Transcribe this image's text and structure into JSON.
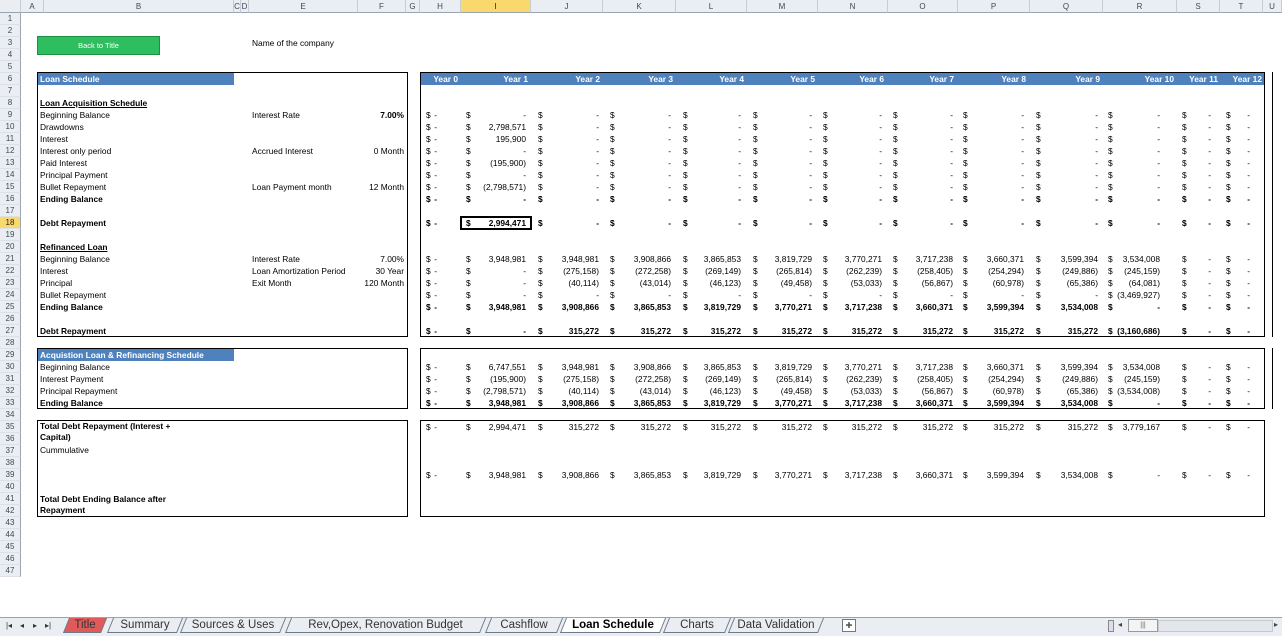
{
  "columns": [
    "A",
    "B",
    "C",
    "D",
    "E",
    "F",
    "G",
    "H",
    "I",
    "J",
    "K",
    "L",
    "M",
    "N",
    "O",
    "P",
    "Q",
    "R",
    "S",
    "T",
    "U"
  ],
  "rows": [
    "1",
    "2",
    "3",
    "4",
    "5",
    "6",
    "7",
    "8",
    "9",
    "10",
    "11",
    "12",
    "13",
    "14",
    "15",
    "16",
    "17",
    "18",
    "19",
    "20",
    "21",
    "22",
    "23",
    "24",
    "25",
    "26",
    "27",
    "28",
    "29",
    "30",
    "31",
    "32",
    "33",
    "34",
    "35",
    "36",
    "37",
    "38",
    "39",
    "40",
    "41",
    "42",
    "43",
    "44",
    "45",
    "46",
    "47"
  ],
  "back_button": "Back to Title",
  "company_label": "Name of the company",
  "loan_schedule_title": "Loan Schedule",
  "years": [
    "Year 0",
    "Year 1",
    "Year 2",
    "Year 3",
    "Year 4",
    "Year 5",
    "Year 6",
    "Year 7",
    "Year 8",
    "Year 9",
    "Year 10",
    "Year 11",
    "Year 12"
  ],
  "acq": {
    "title": "Loan Acquisition Schedule",
    "labels": [
      "Beginning Balance",
      "Drawdowns",
      "Interest",
      "Interest only period",
      "Paid Interest",
      "Principal Payment",
      "Bullet Repayment",
      "Ending Balance"
    ],
    "interest_rate_label": "Interest Rate",
    "interest_rate_value": "7.00%",
    "accrued_label": "Accrued Interest",
    "accrued_value": "0 Month",
    "loan_payment_label": "Loan Payment month",
    "loan_payment_value": "12 Month",
    "rows": [
      [
        "-",
        "-",
        "-",
        "-",
        "-",
        "-",
        "-",
        "-",
        "-",
        "-",
        "-",
        "-",
        "-"
      ],
      [
        "-",
        "2,798,571",
        "-",
        "-",
        "-",
        "-",
        "-",
        "-",
        "-",
        "-",
        "-",
        "-",
        "-"
      ],
      [
        "-",
        "195,900",
        "-",
        "-",
        "-",
        "-",
        "-",
        "-",
        "-",
        "-",
        "-",
        "-",
        "-"
      ],
      [
        "-",
        "-",
        "-",
        "-",
        "-",
        "-",
        "-",
        "-",
        "-",
        "-",
        "-",
        "-",
        "-"
      ],
      [
        "-",
        "(195,900)",
        "-",
        "-",
        "-",
        "-",
        "-",
        "-",
        "-",
        "-",
        "-",
        "-",
        "-"
      ],
      [
        "-",
        "-",
        "-",
        "-",
        "-",
        "-",
        "-",
        "-",
        "-",
        "-",
        "-",
        "-",
        "-"
      ],
      [
        "-",
        "(2,798,571)",
        "-",
        "-",
        "-",
        "-",
        "-",
        "-",
        "-",
        "-",
        "-",
        "-",
        "-"
      ],
      [
        "-",
        "-",
        "-",
        "-",
        "-",
        "-",
        "-",
        "-",
        "-",
        "-",
        "-",
        "-",
        "-"
      ]
    ],
    "debt_label": "Debt Repayment",
    "debt_row": [
      "-",
      "2,994,471",
      "-",
      "-",
      "-",
      "-",
      "-",
      "-",
      "-",
      "-",
      "-",
      "-",
      "-"
    ]
  },
  "refi": {
    "title": "Refinanced Loan",
    "labels": [
      "Beginning Balance",
      "Interest",
      "Principal",
      "Bullet Repayment",
      "Ending Balance"
    ],
    "interest_rate_label": "Interest Rate",
    "interest_rate_value": "7.00%",
    "amort_label": "Loan Amortization Period",
    "amort_value": "30 Year",
    "exit_label": "Exit Month",
    "exit_value": "120 Month",
    "rows": [
      [
        "-",
        "3,948,981",
        "3,948,981",
        "3,908,866",
        "3,865,853",
        "3,819,729",
        "3,770,271",
        "3,717,238",
        "3,660,371",
        "3,599,394",
        "3,534,008",
        "-",
        "-"
      ],
      [
        "-",
        "-",
        "(275,158)",
        "(272,258)",
        "(269,149)",
        "(265,814)",
        "(262,239)",
        "(258,405)",
        "(254,294)",
        "(249,886)",
        "(245,159)",
        "-",
        "-"
      ],
      [
        "-",
        "-",
        "(40,114)",
        "(43,014)",
        "(46,123)",
        "(49,458)",
        "(53,033)",
        "(56,867)",
        "(60,978)",
        "(65,386)",
        "(64,081)",
        "-",
        "-"
      ],
      [
        "-",
        "-",
        "-",
        "-",
        "-",
        "-",
        "-",
        "-",
        "-",
        "-",
        "(3,469,927)",
        "-",
        "-"
      ],
      [
        "-",
        "3,948,981",
        "3,908,866",
        "3,865,853",
        "3,819,729",
        "3,770,271",
        "3,717,238",
        "3,660,371",
        "3,599,394",
        "3,534,008",
        "-",
        "-",
        "-"
      ]
    ],
    "debt_label": "Debt Repayment",
    "debt_row": [
      "-",
      "-",
      "315,272",
      "315,272",
      "315,272",
      "315,272",
      "315,272",
      "315,272",
      "315,272",
      "315,272",
      "(3,160,686)",
      "-",
      "-"
    ]
  },
  "combined": {
    "title": "Acquistion Loan & Refinancing Schedule",
    "labels": [
      "Beginning Balance",
      "Interest Payment",
      "Principal Repayment",
      "Ending Balance"
    ],
    "rows": [
      [
        "-",
        "6,747,551",
        "3,948,981",
        "3,908,866",
        "3,865,853",
        "3,819,729",
        "3,770,271",
        "3,717,238",
        "3,660,371",
        "3,599,394",
        "3,534,008",
        "-",
        "-"
      ],
      [
        "-",
        "(195,900)",
        "(275,158)",
        "(272,258)",
        "(269,149)",
        "(265,814)",
        "(262,239)",
        "(258,405)",
        "(254,294)",
        "(249,886)",
        "(245,159)",
        "-",
        "-"
      ],
      [
        "-",
        "(2,798,571)",
        "(40,114)",
        "(43,014)",
        "(46,123)",
        "(49,458)",
        "(53,033)",
        "(56,867)",
        "(60,978)",
        "(65,386)",
        "(3,534,008)",
        "-",
        "-"
      ],
      [
        "-",
        "3,948,981",
        "3,908,866",
        "3,865,853",
        "3,819,729",
        "3,770,271",
        "3,717,238",
        "3,660,371",
        "3,599,394",
        "3,534,008",
        "-",
        "-",
        "-"
      ]
    ]
  },
  "totals": {
    "debt_label_1": "Total Debt Repayment (Interest +",
    "debt_label_2": "Capital)",
    "cumulative_label": "Cummulative",
    "ending_label_1": "Total Debt Ending Balance after",
    "ending_label_2": "Repayment",
    "debt_row": [
      "-",
      "2,994,471",
      "315,272",
      "315,272",
      "315,272",
      "315,272",
      "315,272",
      "315,272",
      "315,272",
      "315,272",
      "3,779,167",
      "-",
      "-"
    ],
    "ending_row": [
      "-",
      "3,948,981",
      "3,908,866",
      "3,865,853",
      "3,819,729",
      "3,770,271",
      "3,717,238",
      "3,660,371",
      "3,599,394",
      "3,534,008",
      "-",
      "-",
      "-"
    ]
  },
  "currency": "$",
  "sheet_tabs": [
    "Title",
    "Summary",
    "Sources & Uses",
    "Rev,Opex, Renovation Budget",
    "Cashflow",
    "Loan Schedule",
    "Charts",
    "Data Validation"
  ],
  "active_tab": "Loan Schedule",
  "colors": {
    "header_blue": "#4f81bd",
    "button_green": "#2ebe5f",
    "title_tab_red": "#e05a5a"
  }
}
